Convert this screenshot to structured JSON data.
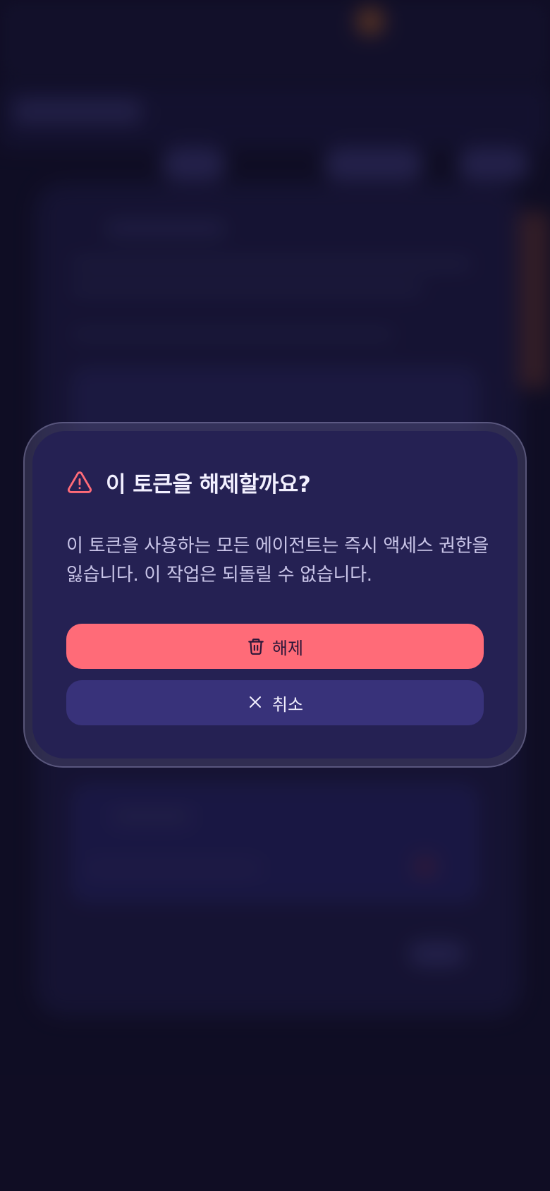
{
  "dialog": {
    "title": "이 토큰을 해제할까요?",
    "message": "이 토큰을 사용하는 모든 에이전트는 즉시 액세스 권한을 잃습니다. 이 작업은 되돌릴 수 없습니다.",
    "confirm_label": "해제",
    "cancel_label": "취소",
    "icons": {
      "title": "warning-triangle-icon",
      "confirm": "trash-icon",
      "cancel": "close-icon"
    },
    "colors": {
      "danger": "#ff6b78",
      "surface": "#252153",
      "secondary_button": "#38327a"
    }
  }
}
